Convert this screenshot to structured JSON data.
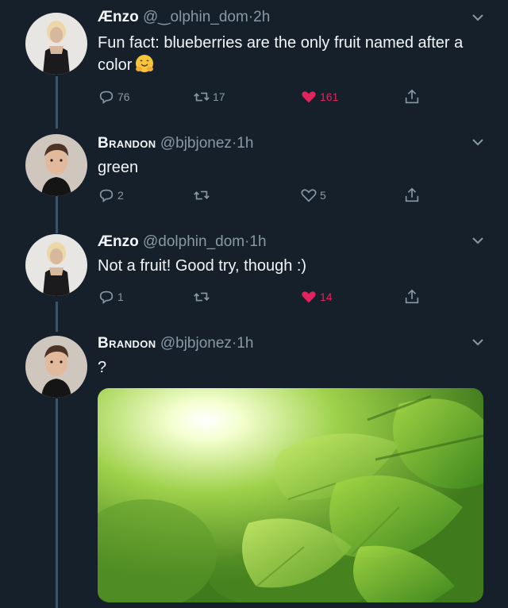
{
  "tweets": [
    {
      "name": "Ænzo",
      "handle": "@dolphin_dom",
      "handle_visible": "@‿olphin_dom",
      "time": "2h",
      "text": "Fun fact: blueberries are the only fruit named after a color",
      "emoji": "hugging-face-icon",
      "replies": "76",
      "retweets": "17",
      "likes": "161",
      "liked": true
    },
    {
      "name": "Brandon",
      "handle": "@bjbjonez",
      "time": "1h",
      "text": "green",
      "replies": "2",
      "retweets": "",
      "likes": "5",
      "liked": false
    },
    {
      "name": "Ænzo",
      "handle": "@dolphin_dom",
      "time": "1h",
      "text": "Not a fruit! Good try, though :)",
      "replies": "1",
      "retweets": "",
      "likes": "14",
      "liked": true
    },
    {
      "name": "Brandon",
      "handle": "@bjbjonez",
      "time": "1h",
      "text": "?",
      "media": "sunlit-green-leaves-photo"
    }
  ],
  "separator": "·",
  "colors": {
    "background": "#15202b",
    "secondary_text": "#8899a6",
    "like_red": "#e0245e",
    "thread_line": "#3d5466"
  }
}
